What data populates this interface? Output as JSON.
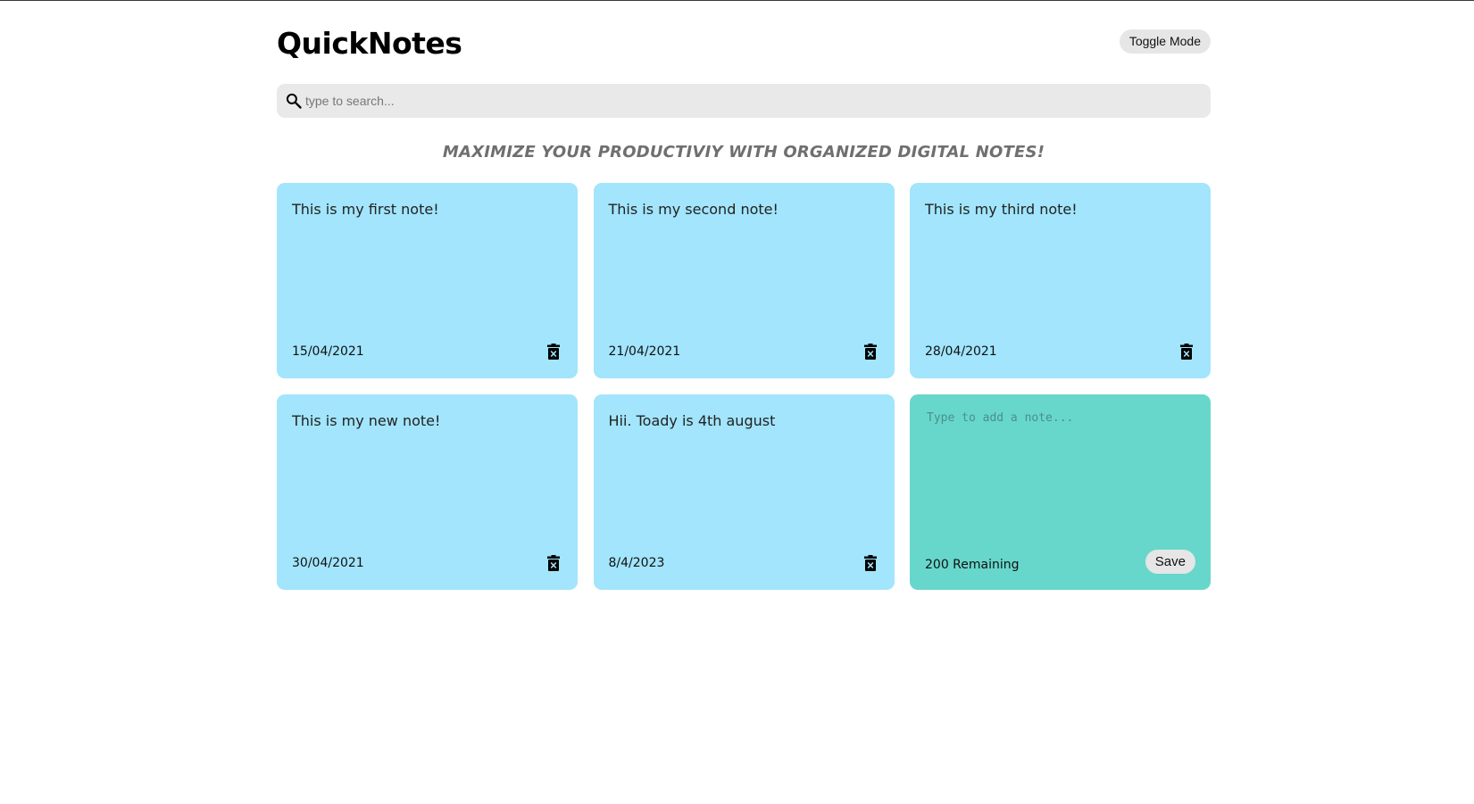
{
  "app": {
    "title": "QuickNotes",
    "toggle_label": "Toggle Mode"
  },
  "search": {
    "placeholder": "type to search...",
    "icon": "search-icon"
  },
  "tagline": "MAXIMIZE YOUR PRODUCTIVIY WITH ORGANIZED DIGITAL NOTES!",
  "notes": [
    {
      "text": "This is my first note!",
      "date": "15/04/2021"
    },
    {
      "text": "This is my second note!",
      "date": "21/04/2021"
    },
    {
      "text": "This is my third note!",
      "date": "28/04/2021"
    },
    {
      "text": "This is my new note!",
      "date": "30/04/2021"
    },
    {
      "text": "Hii. Toady is 4th august",
      "date": "8/4/2023"
    }
  ],
  "new_note": {
    "placeholder": "Type to add a note...",
    "remaining": "200 Remaining",
    "save_label": "Save"
  },
  "colors": {
    "note_bg": "#a2e5fc",
    "new_note_bg": "#67d7cc",
    "button_bg": "#e6e6e6",
    "search_bg": "#e9e9e9"
  }
}
